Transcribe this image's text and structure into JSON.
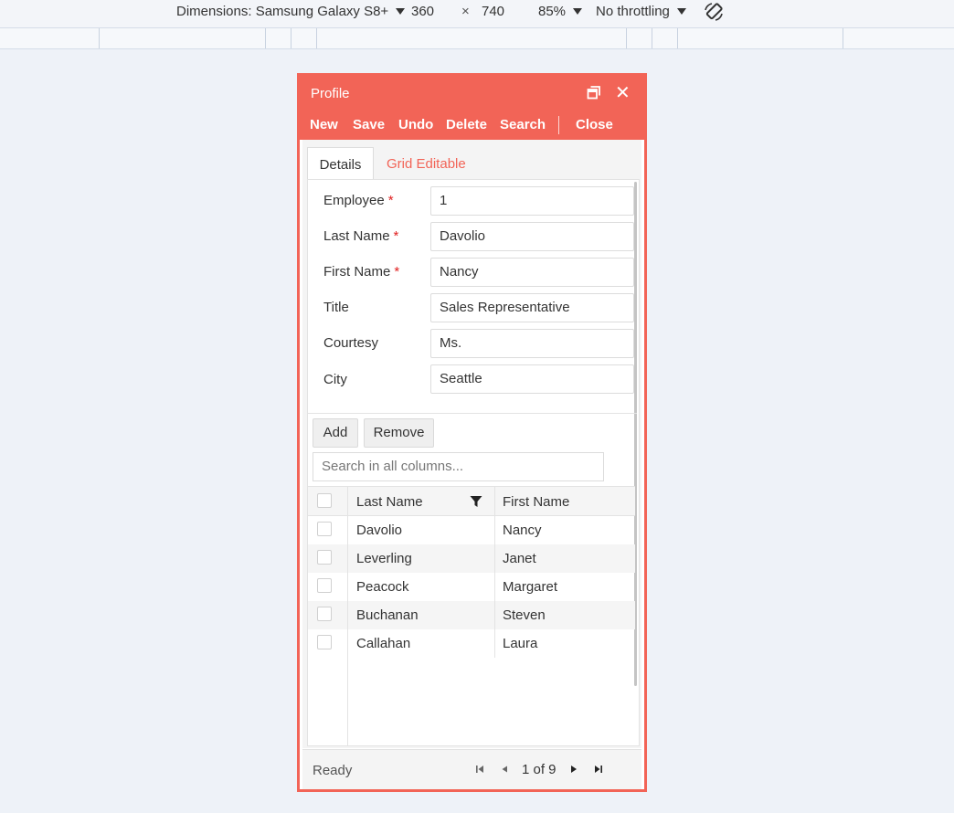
{
  "devtools": {
    "dimensions_label": "Dimensions: Samsung Galaxy S8+",
    "width": "360",
    "times": "×",
    "height": "740",
    "zoom": "85%",
    "throttling": "No throttling",
    "rotate_icon": "rotate-icon"
  },
  "window": {
    "title": "Profile",
    "restore_icon": "restore-icon",
    "close_glyph": "✕",
    "accent_color": "#f26457"
  },
  "toolbar": {
    "new": "New",
    "save": "Save",
    "undo": "Undo",
    "delete": "Delete",
    "search": "Search",
    "close": "Close"
  },
  "tabs": [
    {
      "label": "Details",
      "active": true
    },
    {
      "label": "Grid Editable",
      "active": false
    }
  ],
  "form": {
    "fields": [
      {
        "label": "Employee",
        "required": true,
        "value": "1"
      },
      {
        "label": "Last Name",
        "required": true,
        "value": "Davolio"
      },
      {
        "label": "First Name",
        "required": true,
        "value": "Nancy"
      },
      {
        "label": "Title",
        "required": false,
        "value": "Sales Representative"
      },
      {
        "label": "Courtesy",
        "required": false,
        "value": "Ms."
      },
      {
        "label": "City",
        "required": false,
        "value": "Seattle"
      }
    ],
    "required_mark": "*"
  },
  "grid": {
    "add_label": "Add",
    "remove_label": "Remove",
    "search_placeholder": "Search in all columns...",
    "columns": [
      "Last Name",
      "First Name"
    ],
    "filter_icon": "filter-icon",
    "rows": [
      {
        "last": "Davolio",
        "first": "Nancy"
      },
      {
        "last": "Leverling",
        "first": "Janet"
      },
      {
        "last": "Peacock",
        "first": "Margaret"
      },
      {
        "last": "Buchanan",
        "first": "Steven"
      },
      {
        "last": "Callahan",
        "first": "Laura"
      }
    ]
  },
  "status": {
    "text": "Ready",
    "page_info": "1 of 9",
    "icons": [
      "first-page-icon",
      "prev-page-icon",
      "next-page-icon",
      "last-page-icon"
    ]
  }
}
